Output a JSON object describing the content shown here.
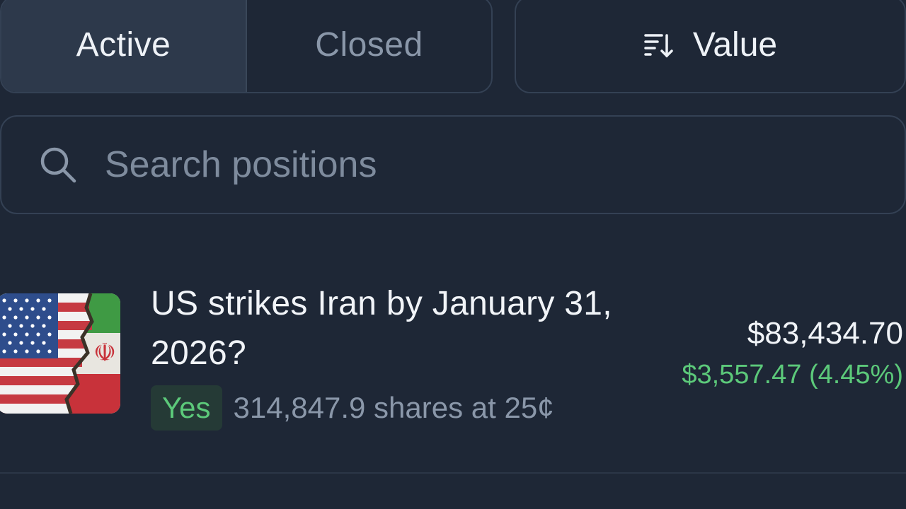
{
  "tabs": {
    "active_label": "Active",
    "closed_label": "Closed"
  },
  "sort": {
    "label": "Value",
    "icon": "sort-descending-icon"
  },
  "search": {
    "placeholder": "Search positions",
    "value": "",
    "icon": "search-icon"
  },
  "position": {
    "title": "US strikes Iran by January 31, 2026?",
    "outcome": "Yes",
    "shares_text": "314,847.9 shares at 25¢",
    "value": "$83,434.70",
    "pnl": "$3,557.47 (4.45%)",
    "thumbnail": "us-iran-flag-thumbnail"
  },
  "colors": {
    "background": "#1e2736",
    "positive": "#5cc97a",
    "border": "#344154"
  }
}
